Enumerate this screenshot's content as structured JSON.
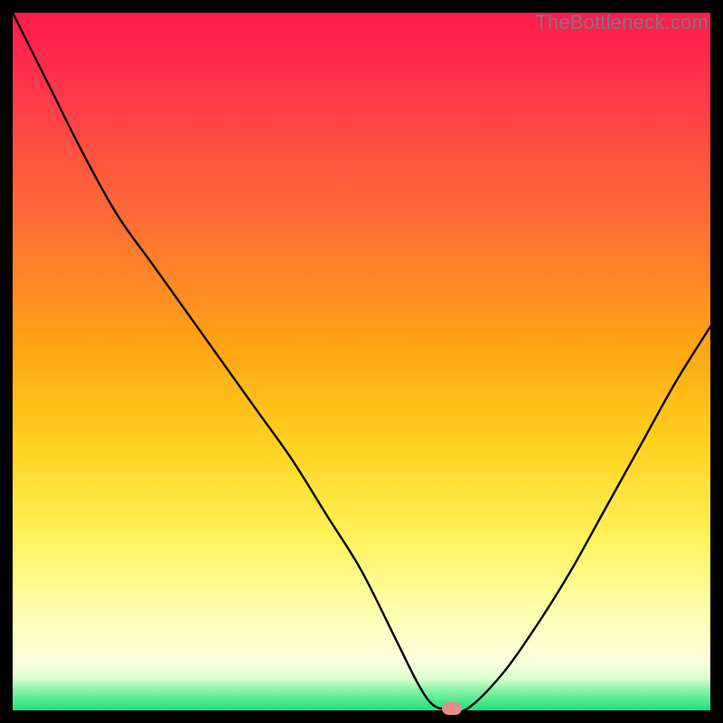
{
  "watermark": "TheBottleneck.com",
  "colors": {
    "top": "#ff1a4f",
    "mid_upper": "#ff7a2a",
    "mid": "#ffd21f",
    "mid_lower": "#ffff6a",
    "pale": "#ffffd0",
    "green": "#1fe07a",
    "curve": "#000000",
    "marker": "#e48b8c"
  },
  "chart_data": {
    "type": "line",
    "title": "",
    "xlabel": "",
    "ylabel": "",
    "xlim": [
      0,
      100
    ],
    "ylim": [
      0,
      100
    ],
    "x": [
      0,
      5,
      10,
      15,
      20,
      25,
      30,
      35,
      40,
      45,
      50,
      55,
      58,
      60,
      62,
      65,
      70,
      75,
      80,
      85,
      90,
      95,
      100
    ],
    "values": [
      100,
      90,
      80,
      71,
      64,
      57,
      50,
      43,
      36,
      28,
      20,
      10,
      4,
      1,
      0,
      0,
      5,
      12,
      20,
      29,
      38,
      47,
      55
    ],
    "minimum_x": 63,
    "marker": {
      "x": 63,
      "y": 0
    },
    "grid": false,
    "legend": false,
    "background_gradient": [
      "red",
      "orange",
      "yellow",
      "pale-yellow",
      "green"
    ]
  }
}
